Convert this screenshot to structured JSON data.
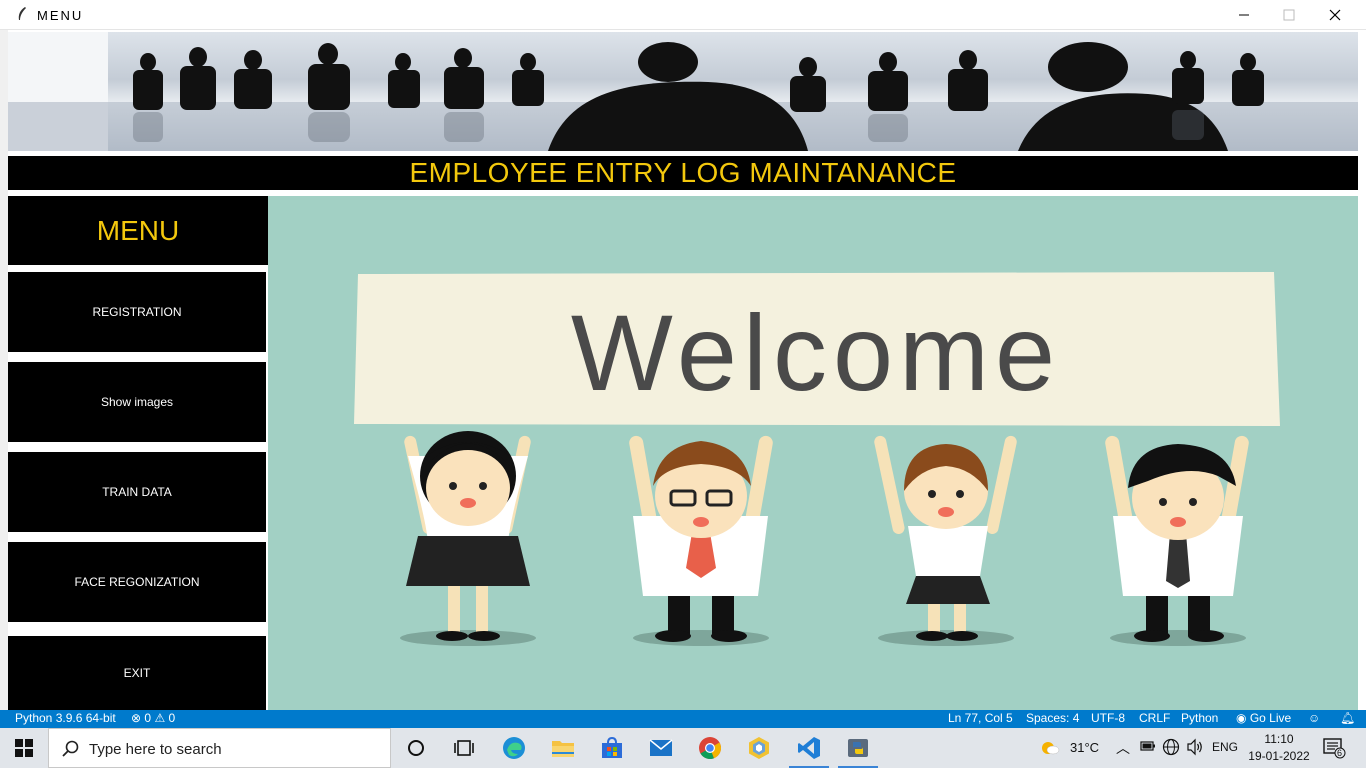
{
  "window": {
    "title": "MENU"
  },
  "app": {
    "header_title": "EMPLOYEE ENTRY LOG MAINTANANCE",
    "menu_title": "MENU",
    "menu_buttons": [
      {
        "label": "REGISTRATION"
      },
      {
        "label": "Show images"
      },
      {
        "label": "TRAIN DATA"
      },
      {
        "label": "FACE REGONIZATION"
      },
      {
        "label": "EXIT"
      }
    ],
    "welcome_text": "Welcome"
  },
  "colors": {
    "accent_yellow": "#f3c80d",
    "panel_teal": "#a2d0c4",
    "statusbar_blue": "#007acc"
  },
  "statusbar": {
    "python": "Python 3.9.6 64-bit",
    "errors": "0",
    "warnings": "0",
    "position": "Ln 77, Col 5",
    "spaces": "Spaces: 4",
    "encoding": "UTF-8",
    "eol": "CRLF",
    "language": "Python",
    "go_live": "Go Live"
  },
  "taskbar": {
    "search_placeholder": "Type here to search",
    "apps": [
      "cortana-icon",
      "task-view-icon",
      "edge-icon",
      "file-explorer-icon",
      "store-icon",
      "mail-icon",
      "chrome-icon",
      "app-hex-icon",
      "vscode-icon",
      "python-icon"
    ],
    "weather": "31°C",
    "language": "ENG",
    "time": "11:10",
    "date": "19-01-2022",
    "notifications": "6"
  }
}
